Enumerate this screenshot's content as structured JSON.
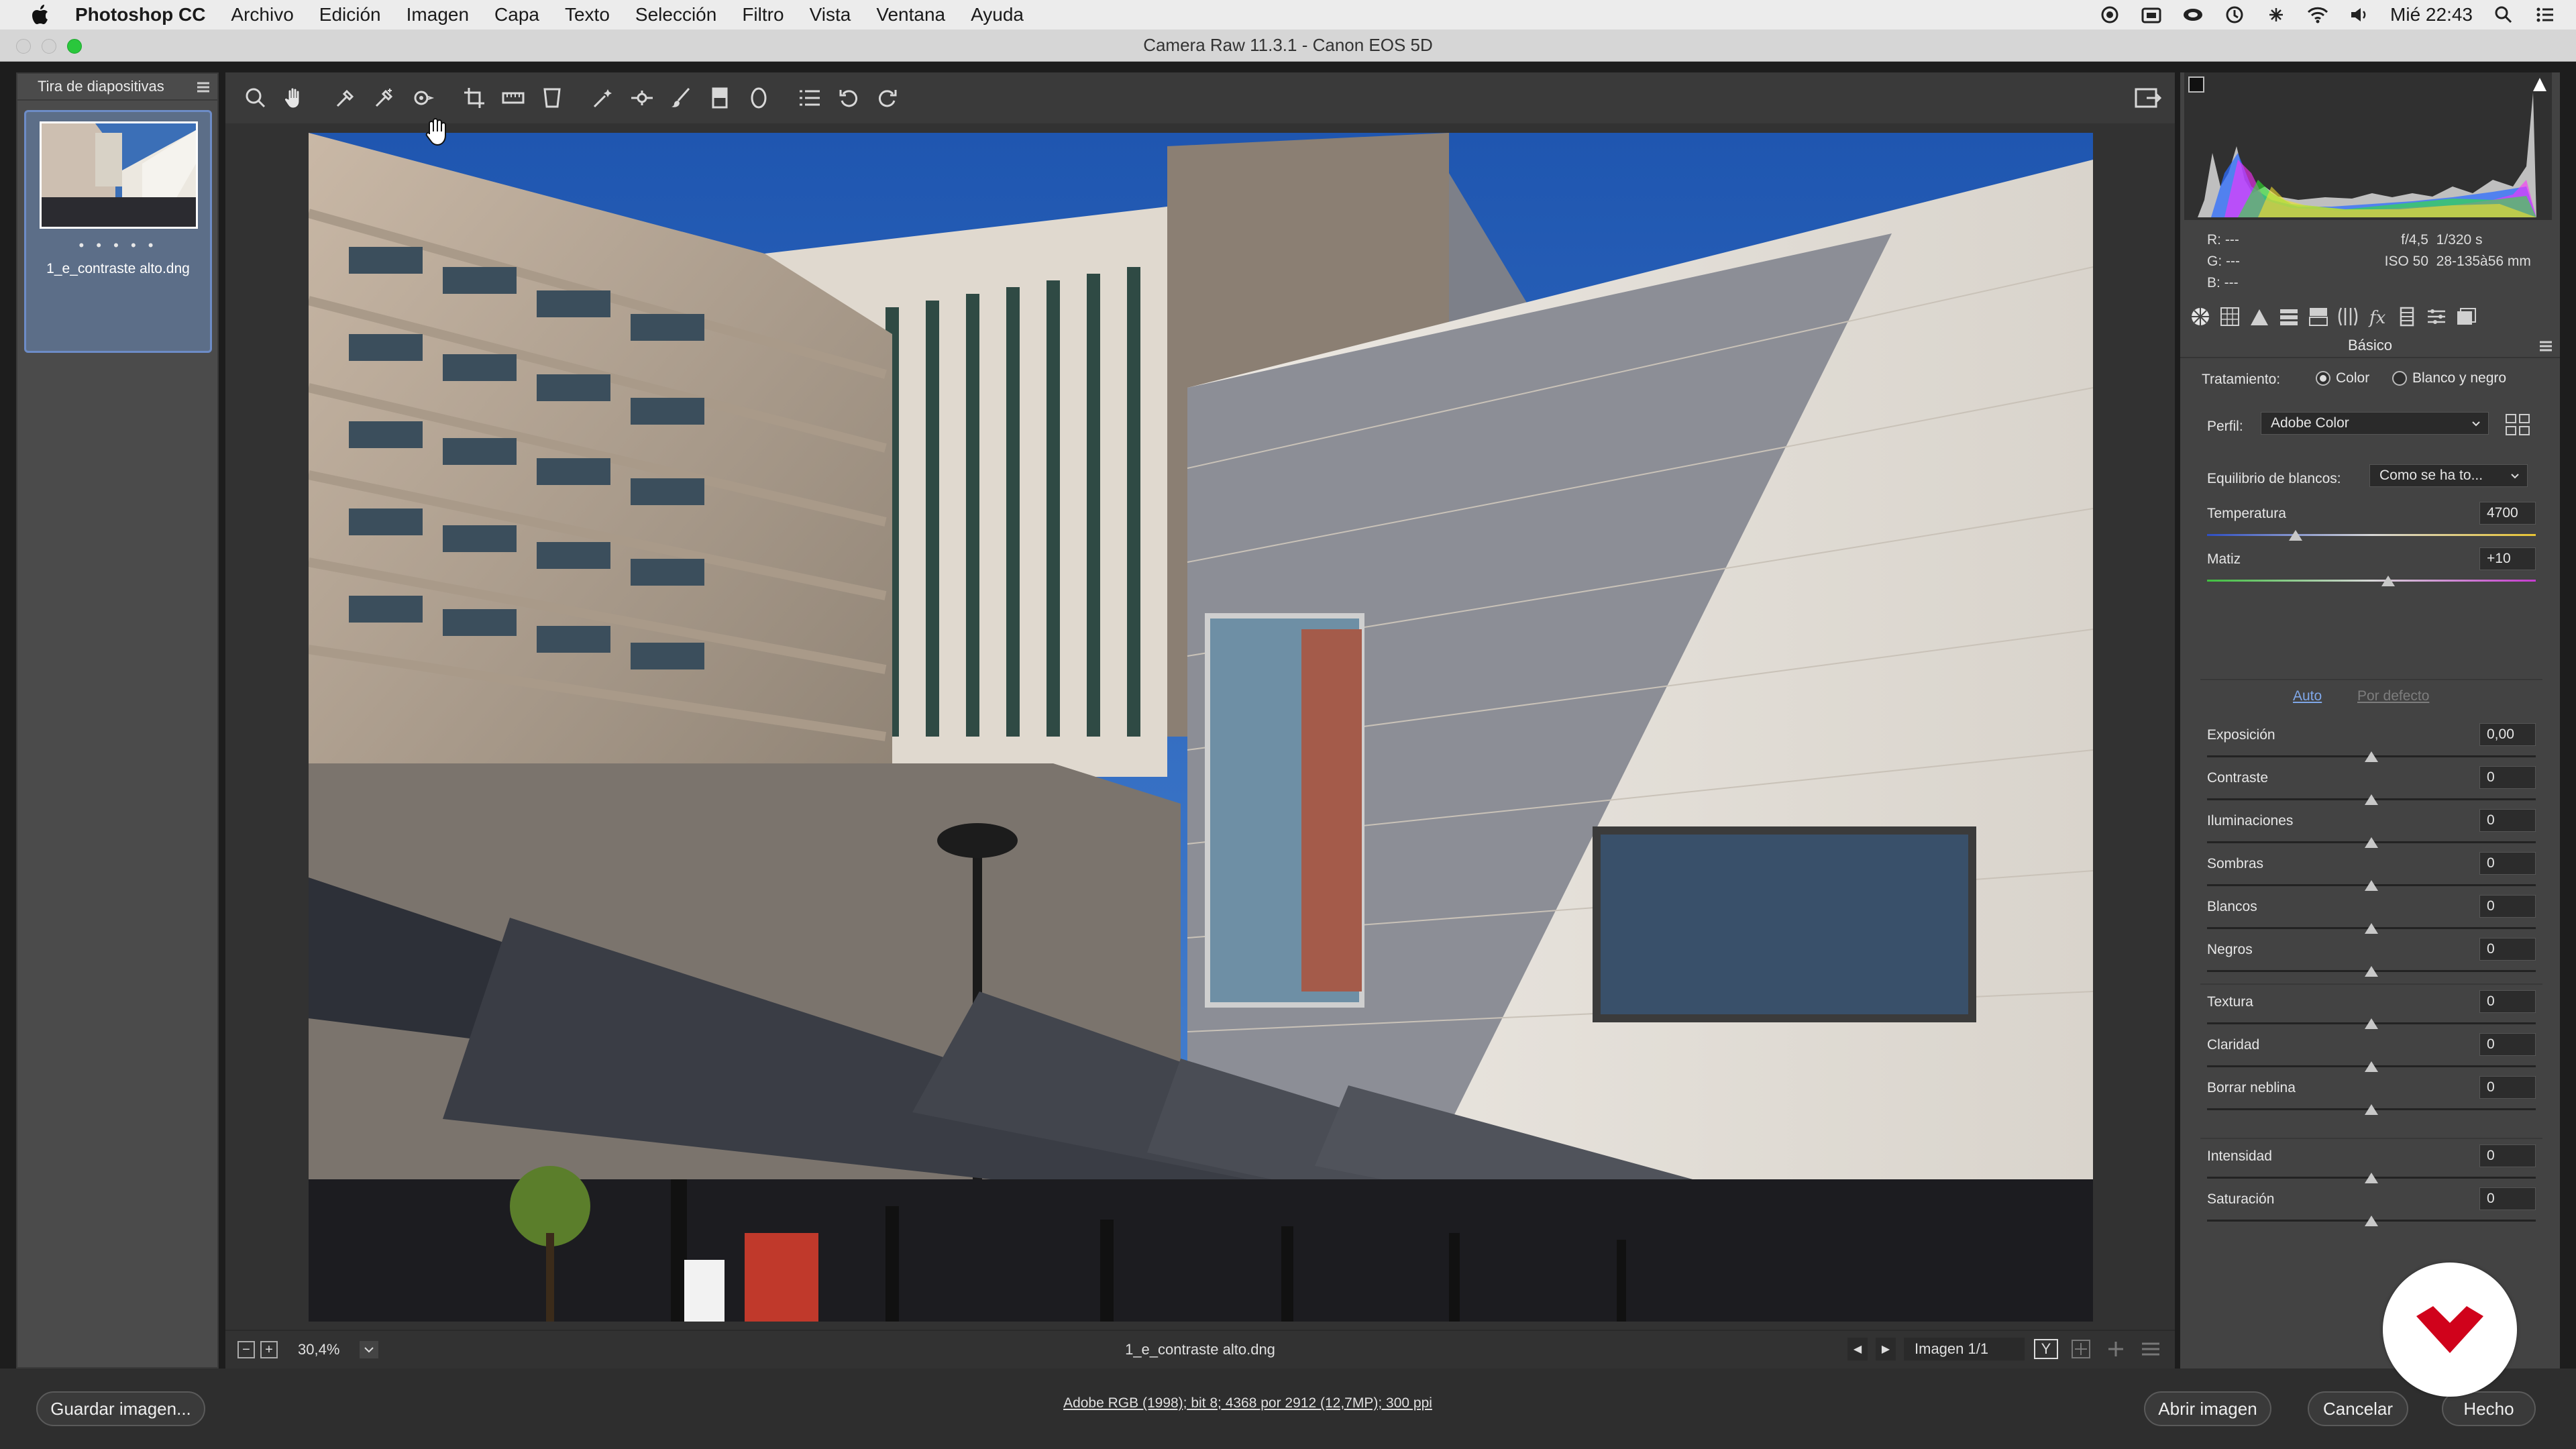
{
  "menubar": {
    "app": "Photoshop CC",
    "items": [
      "Archivo",
      "Edición",
      "Imagen",
      "Capa",
      "Texto",
      "Selección",
      "Filtro",
      "Vista",
      "Ventana",
      "Ayuda"
    ],
    "clock": "Mié 22:43"
  },
  "window": {
    "title": "Camera Raw 11.3.1 -  Canon EOS 5D"
  },
  "filmstrip": {
    "header": "Tira de diapositivas",
    "dots": "• • • • •",
    "thumbnail_label": "1_e_contraste alto.dng"
  },
  "toolbar": {
    "tools": [
      "zoom-icon",
      "hand-icon",
      "white-balance-icon",
      "color-sampler-icon",
      "target-adjust-icon",
      "crop-icon",
      "straighten-icon",
      "transform-icon",
      "spot-removal-icon",
      "red-eye-icon",
      "adjustment-brush-icon",
      "graduated-filter-icon",
      "radial-filter-icon",
      "presets-list-icon",
      "rotate-left-icon",
      "rotate-right-icon"
    ]
  },
  "status": {
    "zoom": "30,4%",
    "filename": "1_e_contraste alto.dng",
    "image_counter": "Imagen 1/1",
    "before_after": "Y"
  },
  "readout": {
    "r": "R:  ---",
    "g": "G:  ---",
    "b": "B:  ---",
    "aperture": "f/4,5",
    "shutter": "1/320 s",
    "iso": "ISO 50",
    "lens": "28-135à56 mm"
  },
  "panel": {
    "title": "Básico",
    "tratamiento_label": "Tratamiento:",
    "color_option": "Color",
    "bw_option": "Blanco y negro",
    "perfil_label": "Perfil:",
    "perfil_value": "Adobe Color",
    "wb_label": "Equilibrio de blancos:",
    "wb_value": "Como se ha to...",
    "auto": "Auto",
    "default": "Por defecto",
    "temperature": {
      "label": "Temperatura",
      "value": "4700",
      "pos": 0.27
    },
    "tint": {
      "label": "Matiz",
      "value": "+10",
      "pos": 0.55
    },
    "sliders_tone": [
      {
        "label": "Exposición",
        "value": "0,00",
        "pos": 0.5
      },
      {
        "label": "Contraste",
        "value": "0",
        "pos": 0.5
      },
      {
        "label": "Iluminaciones",
        "value": "0",
        "pos": 0.5
      },
      {
        "label": "Sombras",
        "value": "0",
        "pos": 0.5
      },
      {
        "label": "Blancos",
        "value": "0",
        "pos": 0.5
      },
      {
        "label": "Negros",
        "value": "0",
        "pos": 0.5
      }
    ],
    "sliders_presence": [
      {
        "label": "Textura",
        "value": "0",
        "pos": 0.5
      },
      {
        "label": "Claridad",
        "value": "0",
        "pos": 0.5
      },
      {
        "label": "Borrar neblina",
        "value": "0",
        "pos": 0.5
      }
    ],
    "sliders_color": [
      {
        "label": "Intensidad",
        "value": "0",
        "pos": 0.5
      },
      {
        "label": "Saturación",
        "value": "0",
        "pos": 0.5
      }
    ]
  },
  "bottom": {
    "save": "Guardar imagen...",
    "workflow": "Adobe RGB (1998); bit 8; 4368 por 2912 (12,7MP); 300 ppi",
    "open": "Abrir imagen",
    "cancel": "Cancelar",
    "done": "Hecho"
  },
  "colors": {
    "accent": "#6d8cc7",
    "link": "#7fa7e8",
    "sky": "#2f6fc4",
    "watermark": "#d0021b"
  }
}
